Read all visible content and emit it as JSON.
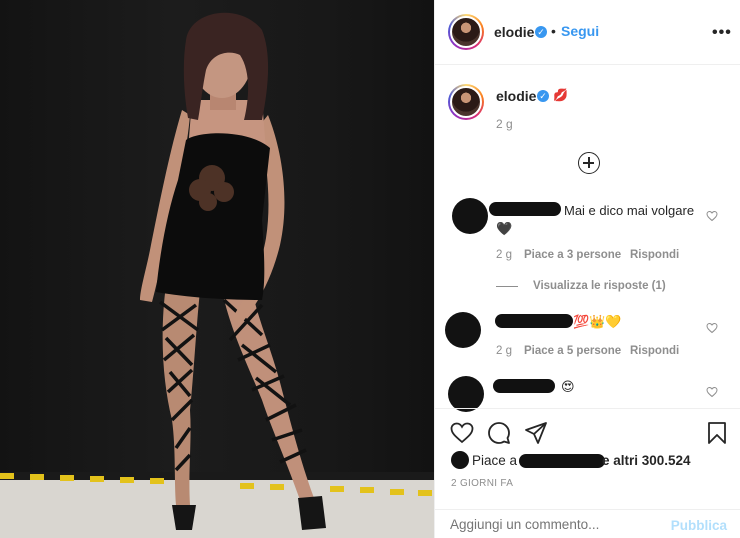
{
  "post": {
    "header": {
      "username": "elodie",
      "verified_mark": "✓",
      "separator": "•",
      "follow_label": "Segui",
      "more_label": "•••"
    },
    "caption": {
      "username": "elodie",
      "emoji": "💋",
      "time": "2 g"
    },
    "comments": [
      {
        "text": "Mai e dico mai volgare 🖤",
        "time": "2 g",
        "likes": "Piace a 3 persone",
        "reply": "Rispondi",
        "view_replies": "Visualizza le risposte (1)"
      },
      {
        "text": "💯👑💛",
        "time": "2 g",
        "likes": "Piace a 5 persone",
        "reply": "Rispondi"
      },
      {
        "text": "😍"
      }
    ],
    "likes_prefix": "Piace a",
    "likes_suffix": "e altri 300.524",
    "date": "2 GIORNI FA",
    "comment_placeholder": "Aggiungi un commento...",
    "publish_label": "Pubblica"
  },
  "icons": {
    "verified": "verified-badge-icon",
    "plus": "plus-circle-icon",
    "heart": "heart-icon",
    "comment": "comment-bubble-icon",
    "share": "paper-plane-icon",
    "save": "bookmark-icon"
  },
  "colors": {
    "link_blue": "#3897f0",
    "publish_disabled": "#b2dffc",
    "muted_text": "#8e8e8e"
  }
}
